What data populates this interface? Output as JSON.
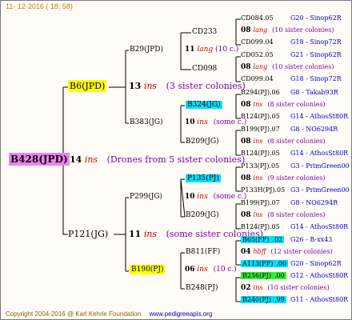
{
  "header": {
    "date": "11- 12-2016 ( 18: 58)"
  },
  "footer": {
    "copyright": "Copyright 2004-2016 @ Karl Kehrle Foundation.",
    "url": "www.pedigreeapis.org"
  },
  "colors": {
    "magenta": "#ee82ee",
    "yellow": "#ffff00",
    "cyan": "#00e0ff",
    "green": "#33ee33",
    "ins_red": "#cc0000",
    "note_purple": "#8000a0",
    "link_blue": "#0000cc"
  },
  "root": {
    "name": "B428(JPD)",
    "count": "14",
    "ins": "ins",
    "note": "(Drones from 5 sister colonies)"
  },
  "gen1": {
    "top": {
      "name": "B6(JPD)",
      "count": "13",
      "ins": "ins",
      "note": "(3 sister colonies)"
    },
    "bottom": {
      "name": "P121(JG)",
      "count": "11",
      "ins": "ins",
      "note": "(some sister colonies)"
    }
  },
  "gen2": {
    "a": {
      "name": "B29(JPD)",
      "count": "11",
      "ins": "lang",
      "note": "(10 c.)"
    },
    "b": {
      "name": "B383(JG)",
      "count": "10",
      "ins": "ins",
      "note": "(some c.)"
    },
    "c": {
      "name": "P299(JG)",
      "count": "10",
      "ins": "ins",
      "note": "(some c.)"
    },
    "d": {
      "name": "B190(PJ)",
      "count": "06",
      "ins": "ins",
      "note": "(10 c.)"
    }
  },
  "gen3": {
    "a1": "CD233",
    "a2": "CD098",
    "b1": "B324(JG)",
    "b2": "B209(JG)",
    "c1": "P135(PJ)",
    "c2": "B209(JG)",
    "d1": "B811(FF)",
    "d2": "B248(PJ)"
  },
  "gen4": [
    {
      "sire": "CD084",
      "year": ".05",
      "link": "G20 - Sinop62R",
      "count": "08",
      "ins": "lang",
      "note": "(10 sister colonies)",
      "dam": "CD099",
      "dyear": ".04",
      "dlink": "G18 - Sinop72R"
    },
    {
      "sire": "CD052",
      "year": ".05",
      "link": "G21 - Sinop62R",
      "count": "08",
      "ins": "lang",
      "note": "(10 sister colonies)",
      "dam": "CD099",
      "dyear": ".04",
      "dlink": "G18 - Sinop72R"
    },
    {
      "sire": "B294(PJ)",
      "year": ".06",
      "link": "G8 - Takab93R",
      "count": "08",
      "ins": "ins",
      "note": "(8 sister colonies)",
      "dam": "B124(PJ)",
      "dyear": ".05",
      "dlink": "G14 - AthosSt80R"
    },
    {
      "sire": "B199(PJ)",
      "year": ".07",
      "link": "G8 - NO6294R",
      "count": "08",
      "ins": "ins",
      "note": "(8 sister colonies)",
      "dam": "B124(PJ)",
      "dyear": ".05",
      "dlink": "G14 - AthosSt80R"
    },
    {
      "sire": "P133(PJ)",
      "year": ".05",
      "link": "G3 - PrimGreen00",
      "count": "08",
      "ins": "ins",
      "note": "(9 sister colonies)",
      "dam": "P133H(PJ)",
      "dyear": ".05",
      "dlink": "G3 - PrimGreen00"
    },
    {
      "sire": "B199(PJ)",
      "year": ".07",
      "link": "G8 - NO6294R",
      "count": "08",
      "ins": "ins",
      "note": "(8 sister colonies)",
      "dam": "B124(PJ)",
      "dyear": ".05",
      "dlink": "G14 - AthosSt80R"
    },
    {
      "sire": "B65(FF)",
      "year": ".02",
      "link": "G26 - B-xx43",
      "count": "04",
      "ins": "hbff",
      "note": "(12 sister colonies)",
      "dam": "A113(FF)",
      "dyear": ".00",
      "dlink": "G20 - Sinop62R"
    },
    {
      "sire": "B256(PJ)",
      "year": ".00",
      "link": "G12 - AthosSt80R",
      "count": "02",
      "ins": "ins",
      "note": "(10 sister colonies)",
      "dam": "B240(PJ)",
      "dyear": ".99",
      "dlink": "G11 - AthosSt80R"
    }
  ]
}
